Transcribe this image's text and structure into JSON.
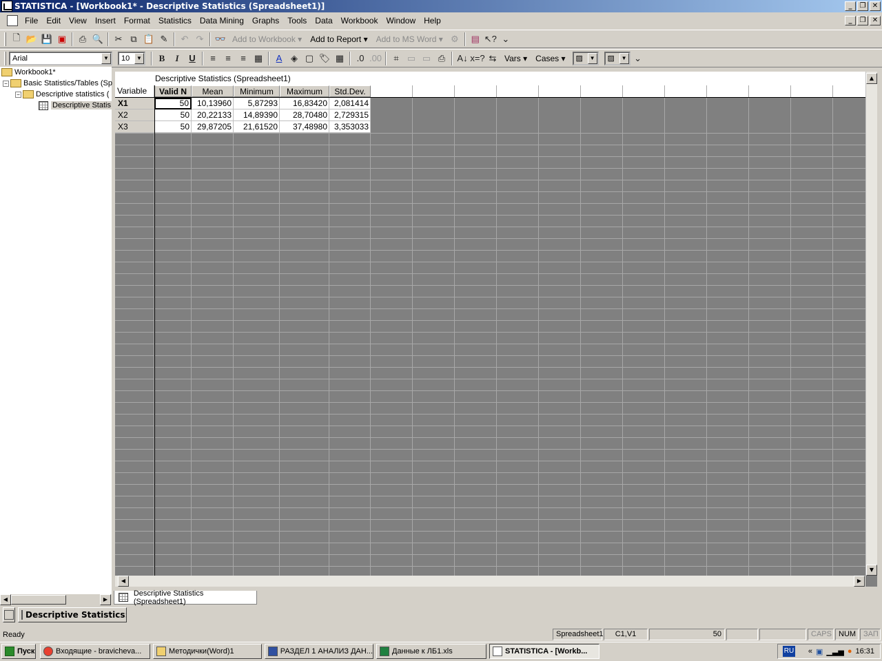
{
  "window": {
    "title": "STATISTICA - [Workbook1* - Descriptive Statistics (Spreadsheet1)]"
  },
  "menu": [
    "File",
    "Edit",
    "View",
    "Insert",
    "Format",
    "Statistics",
    "Data Mining",
    "Graphs",
    "Tools",
    "Data",
    "Workbook",
    "Window",
    "Help"
  ],
  "toolbar1": {
    "add_workbook": "Add to Workbook",
    "add_report": "Add to Report",
    "add_word": "Add to MS Word"
  },
  "toolbar2": {
    "font": "Arial",
    "size": "10",
    "vars": "Vars",
    "cases": "Cases"
  },
  "tree": {
    "root": "Workbook1*",
    "node1": "Basic Statistics/Tables (Sp",
    "node2": "Descriptive statistics (",
    "node3": "Descriptive Statis"
  },
  "spreadsheet": {
    "title": "Descriptive Statistics (Spreadsheet1)",
    "row_header_label": "Variable",
    "columns": [
      "Valid N",
      "Mean",
      "Minimum",
      "Maximum",
      "Std.Dev."
    ],
    "rows": [
      {
        "name": "X1",
        "values": [
          "50",
          "10,13960",
          "5,87293",
          "16,83420",
          "2,081414"
        ]
      },
      {
        "name": "X2",
        "values": [
          "50",
          "20,22133",
          "14,89390",
          "28,70480",
          "2,729315"
        ]
      },
      {
        "name": "X3",
        "values": [
          "50",
          "29,87205",
          "21,61520",
          "37,48980",
          "3,353033"
        ]
      }
    ]
  },
  "sheet_tab": "Descriptive Statistics (Spreadsheet1)",
  "minimized": "Descriptive Statistics:...",
  "status": {
    "ready": "Ready",
    "sheet": "Spreadsheet1",
    "cell": "C1,V1",
    "value": "50",
    "caps": "CAPS",
    "num": "NUM",
    "ovr": "ЗАП"
  },
  "taskbar": {
    "start": "Пуск",
    "items": [
      "Входящие - bravicheva...",
      "Методички(Word)1",
      "РАЗДЕЛ 1 АНАЛИЗ ДАН...",
      "Данные к ЛБ1.xls",
      "STATISTICA - [Workb..."
    ],
    "lang": "RU",
    "time": "16:31"
  }
}
